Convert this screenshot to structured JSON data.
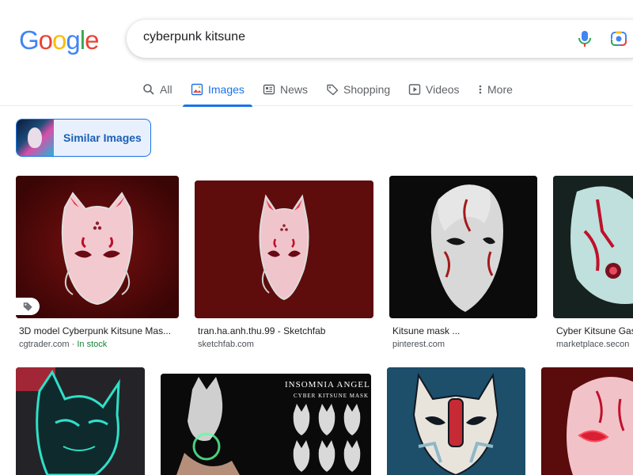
{
  "header": {
    "logo_letters": [
      "G",
      "o",
      "o",
      "g",
      "l",
      "e"
    ],
    "logo_colors": [
      "#4285F4",
      "#EA4335",
      "#FBBC05",
      "#4285F4",
      "#34A853",
      "#EA4335"
    ],
    "search": {
      "value": "cyberpunk kitsune"
    }
  },
  "tabs": [
    {
      "label": "All",
      "icon": "search-icon",
      "active": false
    },
    {
      "label": "Images",
      "icon": "image-icon",
      "active": true
    },
    {
      "label": "News",
      "icon": "news-icon",
      "active": false
    },
    {
      "label": "Shopping",
      "icon": "tag-icon",
      "active": false
    },
    {
      "label": "Videos",
      "icon": "play-icon",
      "active": false
    },
    {
      "label": "More",
      "icon": "more-vert-icon",
      "active": false
    }
  ],
  "similar": {
    "label": "Similar Images"
  },
  "results": [
    {
      "title": "3D model Cyberpunk Kitsune Mas...",
      "source": "cgtrader.com",
      "extra": "In stock",
      "badge": "tag-icon"
    },
    {
      "title": "tran.ha.anh.thu.99 - Sketchfab",
      "source": "sketchfab.com"
    },
    {
      "title": "Kitsune mask ...",
      "source": "pinterest.com"
    },
    {
      "title": "Cyber Kitsune Gas",
      "source": "marketplace.secon"
    }
  ],
  "row2": [
    {
      "overlay_title": "",
      "overlay_sub": ""
    },
    {
      "overlay_title": "INSOMNIA ANGEL",
      "overlay_sub": "CYBER KITSUNE MASK"
    },
    {
      "overlay_title": "",
      "overlay_sub": ""
    },
    {
      "overlay_title": "",
      "overlay_sub": ""
    }
  ],
  "colors": {
    "accent": "#1a73e8",
    "stock": "#188038"
  }
}
